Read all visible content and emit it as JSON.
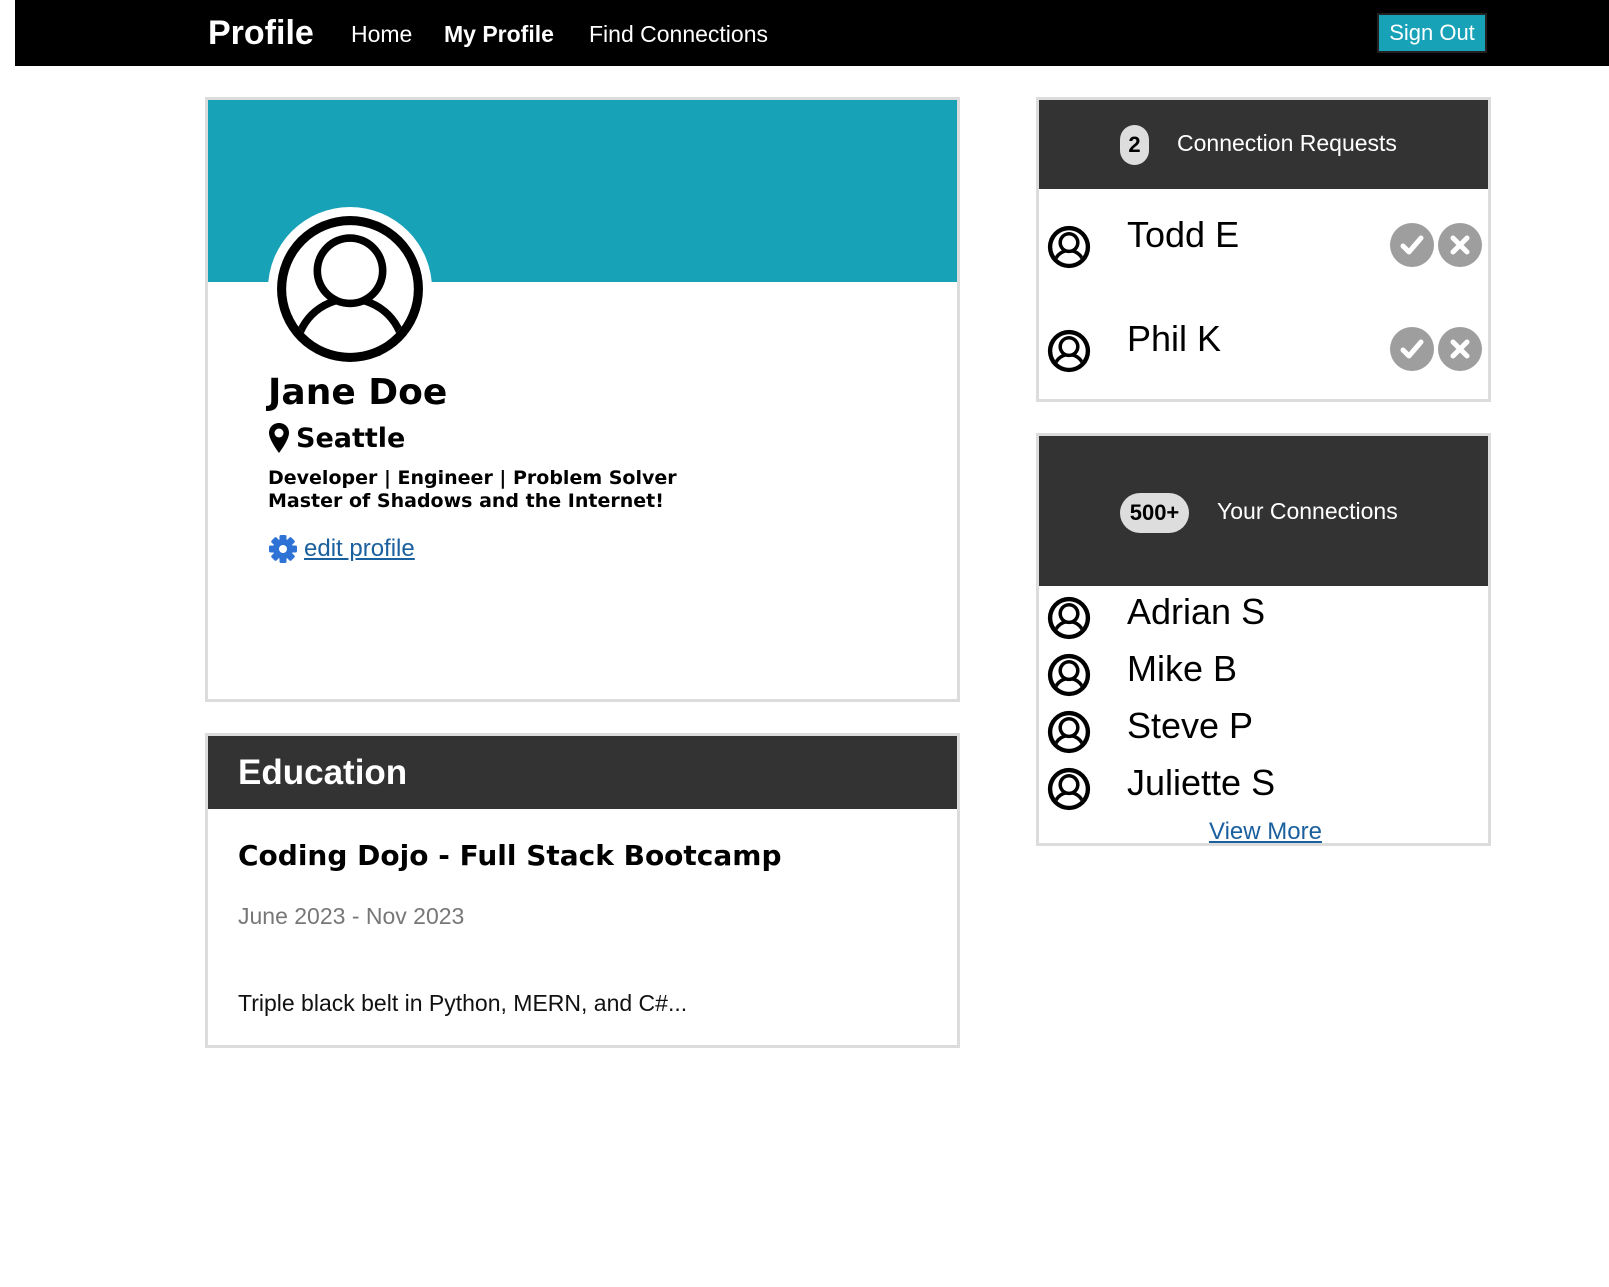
{
  "navbar": {
    "brand": "Profile",
    "links": [
      "Home",
      "My Profile",
      "Find Connections"
    ],
    "sign_out_label": "Sign Out"
  },
  "profile": {
    "name": "Jane Doe",
    "location": "Seattle",
    "tagline_line1": "Developer | Engineer | Problem Solver",
    "tagline_line2": "Master of Shadows and the Internet!",
    "edit_label": "edit profile"
  },
  "education": {
    "heading": "Education",
    "school": "Coding Dojo - Full Stack Bootcamp",
    "dates": "June 2023 - Nov 2023",
    "description": "Triple black belt in Python, MERN, and C#..."
  },
  "requests": {
    "count": "2",
    "heading": "Connection Requests",
    "people": [
      "Todd E",
      "Phil K"
    ]
  },
  "connections": {
    "count": "500+",
    "heading": "Your Connections",
    "people": [
      "Adrian S",
      "Mike B",
      "Steve P",
      "Juliette S"
    ],
    "view_more_label": "View More"
  },
  "colors": {
    "navbar": "#000000",
    "accent": "#17a2b8",
    "card_header": "#333333",
    "link": "#1a5f9e",
    "action_button": "#9e9e9e",
    "gear_icon": "#2f72d6"
  },
  "icons": {
    "location": "map-pin-icon",
    "edit": "gear-icon",
    "person": "user-circle-icon",
    "accept": "check-icon",
    "decline": "close-icon"
  }
}
